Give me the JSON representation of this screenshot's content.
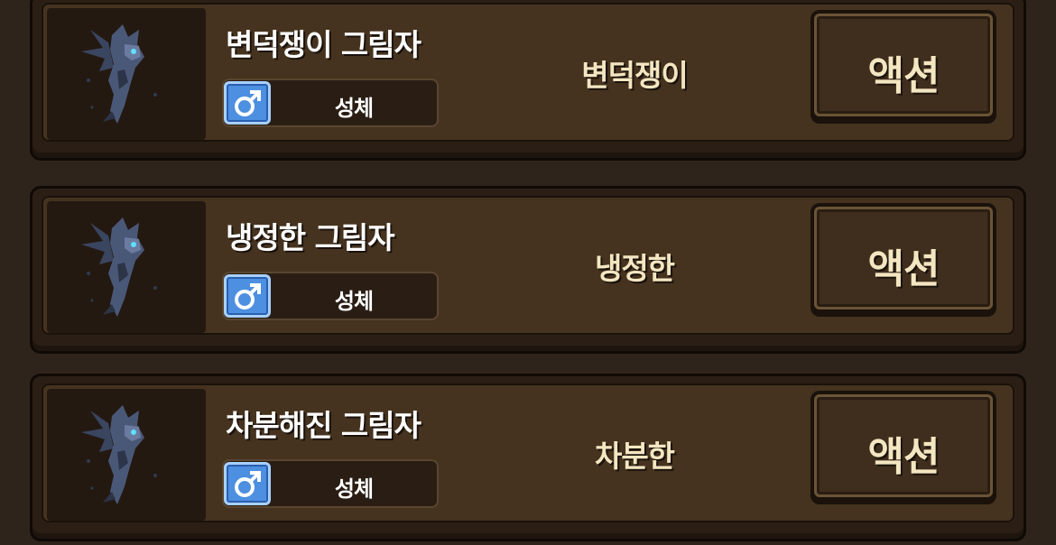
{
  "colors": {
    "background": "#2f241b",
    "card": "#45331f",
    "name_text": "#ffffff",
    "trait_text": "#f3e6c1",
    "gender_badge": "#4d8fe0"
  },
  "shadows": [
    {
      "name": "변덕쟁이 그림자",
      "gender_icon": "male-symbol-icon",
      "stage": "성체",
      "trait": "변덕쟁이",
      "action_label": "액션"
    },
    {
      "name": "냉정한 그림자",
      "gender_icon": "male-symbol-icon",
      "stage": "성체",
      "trait": "냉정한",
      "action_label": "액션"
    },
    {
      "name": "차분해진 그림자",
      "gender_icon": "male-symbol-icon",
      "stage": "성체",
      "trait": "차분한",
      "action_label": "액션"
    }
  ]
}
